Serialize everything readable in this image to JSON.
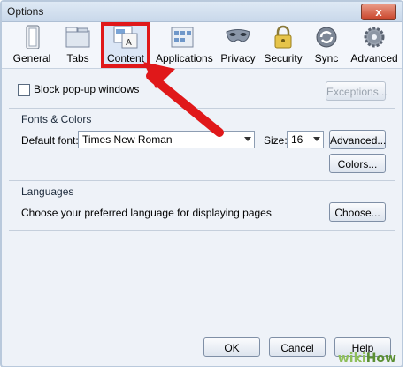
{
  "window": {
    "title": "Options",
    "close_label": "x"
  },
  "toolbar": {
    "items": [
      {
        "label": "General",
        "icon": "general-icon"
      },
      {
        "label": "Tabs",
        "icon": "tabs-icon"
      },
      {
        "label": "Content",
        "icon": "content-icon",
        "selected": true
      },
      {
        "label": "Applications",
        "icon": "applications-icon"
      },
      {
        "label": "Privacy",
        "icon": "privacy-mask-icon"
      },
      {
        "label": "Security",
        "icon": "lock-icon"
      },
      {
        "label": "Sync",
        "icon": "sync-icon"
      },
      {
        "label": "Advanced",
        "icon": "gear-icon"
      }
    ]
  },
  "content": {
    "popups": {
      "label": "Block pop-up windows",
      "checked": false,
      "exceptions_label": "Exceptions..."
    },
    "fonts": {
      "section_title": "Fonts & Colors",
      "default_font_label": "Default font:",
      "default_font_value": "Times New Roman",
      "size_label": "Size:",
      "size_value": "16",
      "advanced_label": "Advanced...",
      "colors_label": "Colors..."
    },
    "languages": {
      "section_title": "Languages",
      "description": "Choose your preferred language for displaying pages",
      "choose_label": "Choose..."
    }
  },
  "footer": {
    "ok_label": "OK",
    "cancel_label": "Cancel",
    "help_label": "Help"
  },
  "watermark": {
    "wiki": "wiki",
    "how": "How"
  },
  "colors": {
    "highlight_red": "#e0181a",
    "window_bg": "#eef2f8"
  }
}
